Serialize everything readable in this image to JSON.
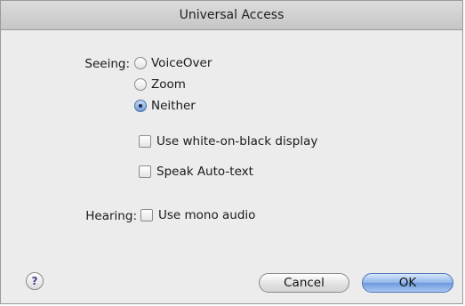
{
  "window": {
    "title": "Universal Access"
  },
  "seeing": {
    "label": "Seeing:",
    "options": [
      {
        "label": "VoiceOver",
        "selected": false
      },
      {
        "label": "Zoom",
        "selected": false
      },
      {
        "label": "Neither",
        "selected": true
      }
    ],
    "checkboxes": [
      {
        "label": "Use white-on-black display",
        "checked": false
      },
      {
        "label": "Speak Auto-text",
        "checked": false
      }
    ]
  },
  "hearing": {
    "label": "Hearing:",
    "checkbox": {
      "label": "Use mono audio",
      "checked": false
    }
  },
  "buttons": {
    "help": "?",
    "cancel": "Cancel",
    "ok": "OK"
  }
}
